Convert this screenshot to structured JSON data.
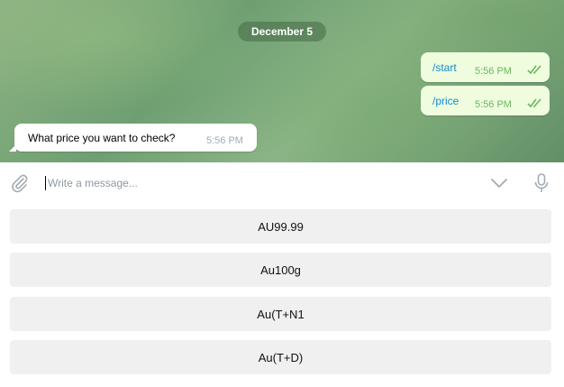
{
  "date_label": "December 5",
  "messages": {
    "out": [
      {
        "text": "/start",
        "time": "5:56 PM"
      },
      {
        "text": "/price",
        "time": "5:56 PM"
      }
    ],
    "in": [
      {
        "text": "What price you want to check?",
        "time": "5:56 PM"
      }
    ]
  },
  "composer": {
    "placeholder": "Write a message..."
  },
  "keyboard": [
    "AU99.99",
    "Au100g",
    "Au(T+N1",
    "Au(T+D)"
  ],
  "icons": {
    "attach": "paperclip-icon",
    "expand": "chevron-down-icon",
    "voice": "microphone-icon",
    "read": "double-check-icon"
  },
  "colors": {
    "outgoing_bubble": "#effdde",
    "command_link": "#168acd",
    "read_ticks": "#6cb561"
  }
}
